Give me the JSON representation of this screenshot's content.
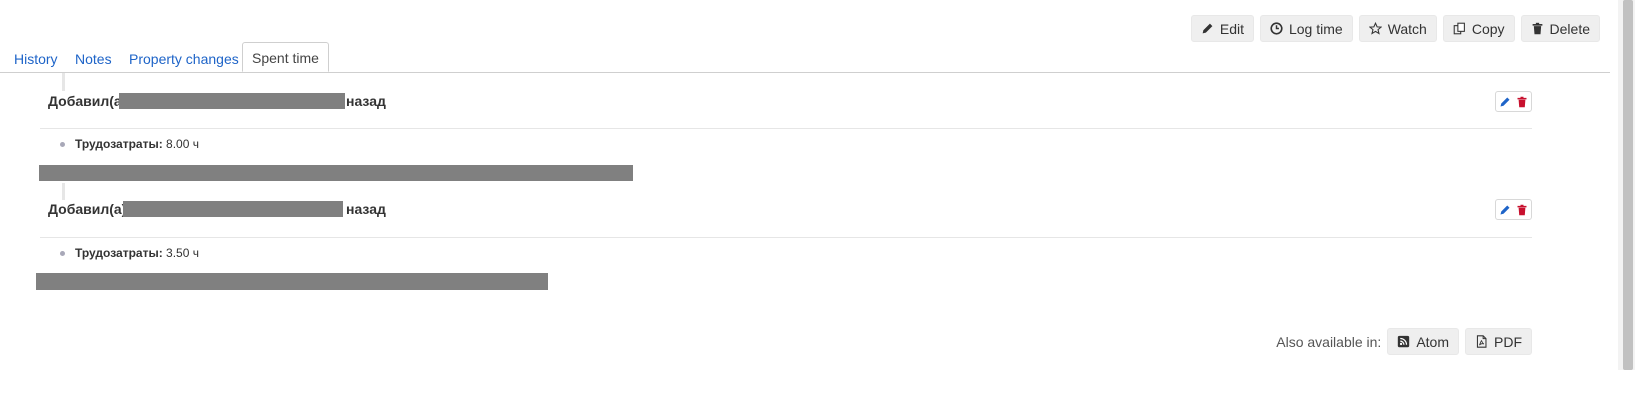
{
  "actions": {
    "edit": "Edit",
    "log_time": "Log time",
    "watch": "Watch",
    "copy": "Copy",
    "delete": "Delete"
  },
  "tabs": [
    {
      "label": "History",
      "active": false
    },
    {
      "label": "Notes",
      "active": false
    },
    {
      "label": "Property changes",
      "active": false
    },
    {
      "label": "Spent time",
      "active": true
    }
  ],
  "entries": [
    {
      "prefix": "Добавил(а)",
      "suffix": "назад",
      "detail_label": "Трудозатраты:",
      "detail_value": "8.00 ч"
    },
    {
      "prefix": "Добавил(а)",
      "suffix": "назад",
      "detail_label": "Трудозатраты:",
      "detail_value": "3.50 ч"
    }
  ],
  "other_formats": {
    "label": "Also available in:",
    "atom": "Atom",
    "pdf": "PDF"
  },
  "colors": {
    "link": "#1e64c8",
    "danger": "#c8102e",
    "redaction": "#808080"
  }
}
